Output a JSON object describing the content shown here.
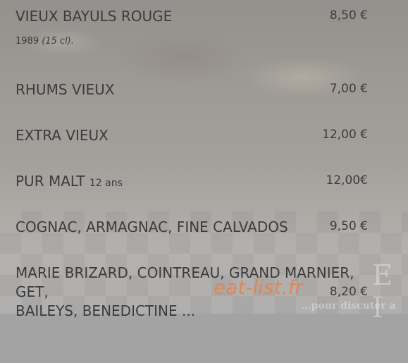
{
  "items": [
    {
      "name": "VIEUX BAYULS ROUGE",
      "note_year": "1989",
      "note_volume": "(15 cl).",
      "price": "8,50 €"
    },
    {
      "name": "RHUMS VIEUX",
      "price": "7,00 €"
    },
    {
      "name": "EXTRA VIEUX",
      "price": "12,00 €"
    },
    {
      "name": "PUR MALT",
      "suffix": "12 ans",
      "price": "12,00€"
    },
    {
      "name": "COGNAC, ARMAGNAC, FINE CALVADOS",
      "price": "9,50 €"
    },
    {
      "name_line1": "MARIE BRIZARD, COINTREAU, GRAND MARNIER, GET,",
      "name_line2": "BAILEYS, BENEDICTINE ...",
      "price": "8,20 €"
    }
  ],
  "watermark": "eat-list.fr",
  "background": {
    "sign_text": "E I",
    "tagline": "...pour discuter a"
  },
  "colors": {
    "text": "#3c3c3c",
    "watermark": "#e87e42"
  }
}
